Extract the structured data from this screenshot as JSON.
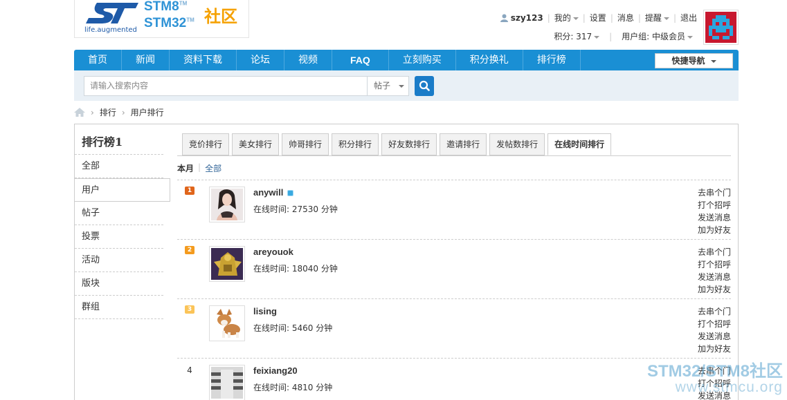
{
  "header": {
    "logo_tag": "life.augmented",
    "logo_stm8": "STM8",
    "logo_stm32": "STM32",
    "logo_tm": "TM",
    "logo_cn": "社区",
    "username": "szy123",
    "menu": [
      "我的",
      "设置",
      "消息",
      "提醒",
      "退出"
    ],
    "points": "积分: 317",
    "group": "用户组: 中级会员"
  },
  "nav": {
    "items": [
      "首页",
      "新闻",
      "资料下载",
      "论坛",
      "视频",
      "FAQ",
      "立刻购买",
      "积分换礼",
      "排行榜"
    ],
    "quick_nav": "快捷导航"
  },
  "search": {
    "placeholder": "请输入搜索内容",
    "type": "帖子"
  },
  "breadcrumb": [
    "排行",
    "用户排行"
  ],
  "sidebar": {
    "title": "排行榜1",
    "items": [
      "全部",
      "用户",
      "帖子",
      "投票",
      "活动",
      "版块",
      "群组"
    ]
  },
  "tabs": [
    "竞价排行",
    "美女排行",
    "帅哥排行",
    "积分排行",
    "好友数排行",
    "邀请排行",
    "发帖数排行",
    "在线时间排行"
  ],
  "subtabs": {
    "current": "本月",
    "all": "全部"
  },
  "actions": [
    "去串个门",
    "打个招呼",
    "发送消息",
    "加为好友"
  ],
  "users": [
    {
      "rank": "1",
      "name": "anywill",
      "online": "在线时间: 27530 分钟"
    },
    {
      "rank": "2",
      "name": "areyouok",
      "online": "在线时间: 18040 分钟"
    },
    {
      "rank": "3",
      "name": "lising",
      "online": "在线时间: 5460 分钟"
    },
    {
      "rank": "4",
      "name": "feixiang20",
      "online": "在线时间: 4810 分钟"
    }
  ],
  "watermark": {
    "line1": "STM32/STM8社区",
    "line2": "www.stmcu.org"
  }
}
